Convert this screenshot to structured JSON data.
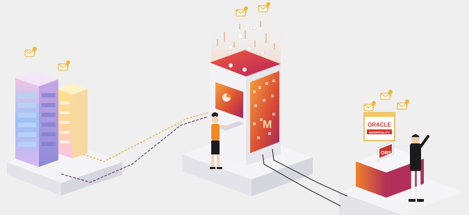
{
  "labels": {
    "oracle": "ORACLE",
    "hospitality": "HOSPITALITY",
    "ors": "ORS",
    "monitor_mark": "M"
  },
  "icons": [
    "envelope-key-icon",
    "envelope-key-icon",
    "envelope-key-icon",
    "envelope-key-icon",
    "envelope-key-icon",
    "envelope-key-icon",
    "envelope-key-icon"
  ],
  "colors": {
    "background": "#efefef",
    "platform_top": "#f4f4f7",
    "accent_orange": "#f08a24",
    "accent_magenta": "#a8326e",
    "accent_red": "#d9332b",
    "line_gold": "#e3b23c",
    "line_purple": "#6c3b6f",
    "building_blue": "#8fb3f2",
    "dark": "#1b1b1b"
  }
}
